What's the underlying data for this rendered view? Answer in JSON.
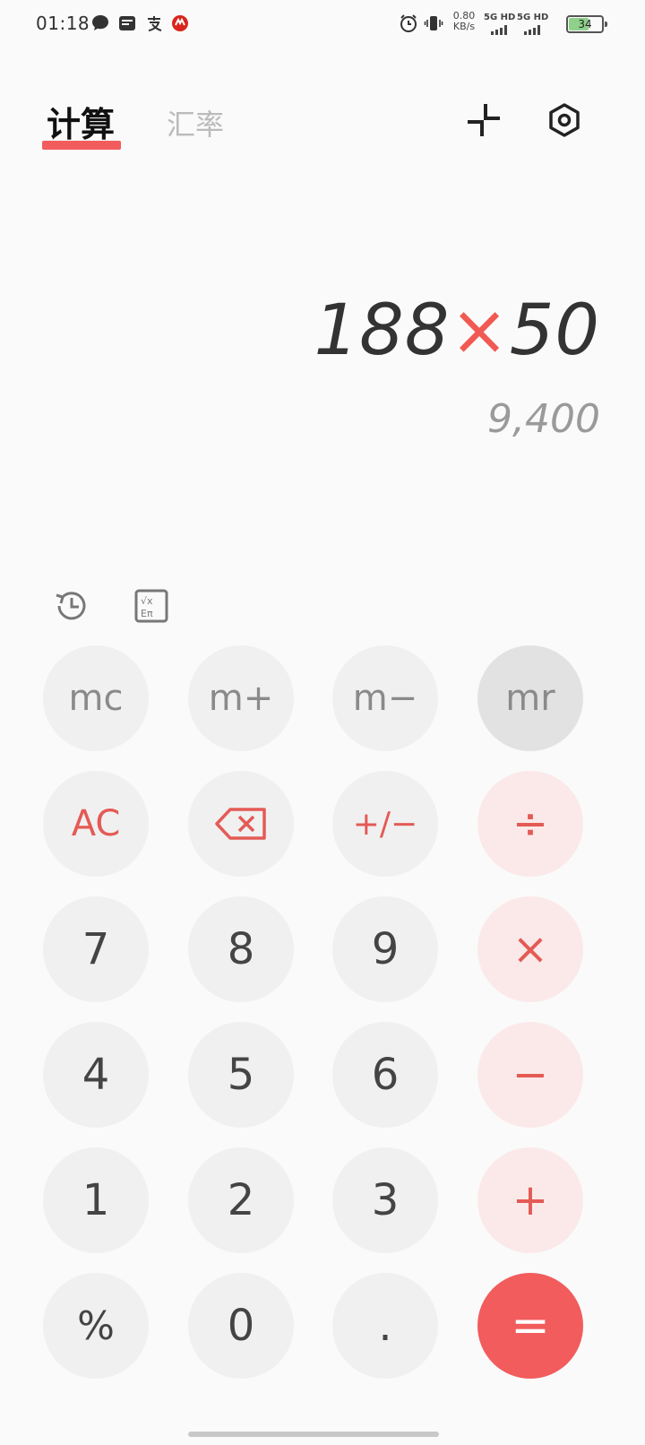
{
  "status_bar": {
    "time": "01:18",
    "net_speed_value": "0.80",
    "net_speed_unit": "KB/s",
    "sim1": "5G HD",
    "sim2": "5G HD",
    "battery": "34",
    "battery_level": 0.34,
    "icons": [
      "chat-icon",
      "wallet-icon",
      "alipay-icon",
      "bank-icon",
      "alarm-icon",
      "vibrate-icon"
    ]
  },
  "tabs": [
    {
      "label": "计算",
      "active": true
    },
    {
      "label": "汇率",
      "active": false
    }
  ],
  "header_icons": [
    "collapse-icon",
    "settings-icon"
  ],
  "display": {
    "operand1": "188",
    "operator": "×",
    "operand2": "50",
    "result": "9,400"
  },
  "tools": [
    "history-icon",
    "scientific-icon"
  ],
  "keys": {
    "mc": "mc",
    "mplus": "m+",
    "mminus": "m−",
    "mr": "mr",
    "ac": "AC",
    "sign": "+/−",
    "divide": "÷",
    "k7": "7",
    "k8": "8",
    "k9": "9",
    "multiply": "×",
    "k4": "4",
    "k5": "5",
    "k6": "6",
    "minus": "−",
    "k1": "1",
    "k2": "2",
    "k3": "3",
    "plus": "+",
    "percent": "%",
    "k0": "0",
    "dot": ".",
    "equals": "="
  },
  "colors": {
    "accent": "#f25c5c",
    "operator_bg": "#fbe9e9",
    "key_bg": "#f0f0f0"
  }
}
